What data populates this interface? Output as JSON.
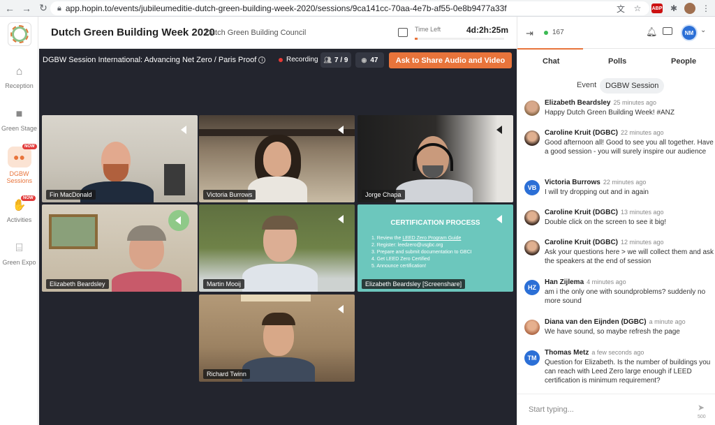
{
  "browser": {
    "url": "app.hopin.to/events/jubileumeditie-dutch-green-building-week-2020/sessions/9ca141cc-70aa-4e7b-af55-0e8b9477a33f",
    "abp_label": "ABP"
  },
  "sidebar": {
    "items": [
      {
        "label": "Reception",
        "icon": "home-icon"
      },
      {
        "label": "Green Stage",
        "icon": "video-icon"
      },
      {
        "label": "DGBW Sessions",
        "icon": "sessions-icon",
        "badge": "NOW"
      },
      {
        "label": "Activities",
        "icon": "activities-icon",
        "badge": "NOW"
      },
      {
        "label": "Green Expo",
        "icon": "expo-icon"
      }
    ]
  },
  "header": {
    "event_title": "Dutch Green Building Week 2020",
    "organizer": "Dutch Green Building Council",
    "time_left_label": "Time Left",
    "time_left_value": "4d:2h:25m",
    "time_progress": 0.03
  },
  "stage": {
    "session_title": "DGBW Session International: Advancing Net Zero / Paris Proof",
    "recording_label": "Recording",
    "speakers_count": "7 / 9",
    "viewers_count": "47",
    "share_button": "Ask to Share Audio and Video",
    "tiles": [
      {
        "name": "Fin MacDonald"
      },
      {
        "name": "Victoria Burrows"
      },
      {
        "name": "Jorge Chapa"
      },
      {
        "name": "Elizabeth Beardsley"
      },
      {
        "name": "Martin Mooij"
      },
      {
        "name": "Elizabeth Beardsley [Screenshare]"
      },
      {
        "name": "Richard Twinn"
      }
    ],
    "screenshare": {
      "title": "CERTIFICATION PROCESS",
      "steps": [
        {
          "n": "1.",
          "pre": "Review the ",
          "link": "LEED Zero Program Guide"
        },
        {
          "n": "2.",
          "pre": "Register: leedzero@usgbc.org",
          "link": ""
        },
        {
          "n": "3.",
          "pre": "Prepare and submit documentation to GBCI",
          "link": ""
        },
        {
          "n": "4.",
          "pre": "Get LEED Zero Certified",
          "link": ""
        },
        {
          "n": "5.",
          "pre": "Announce certification!",
          "link": ""
        }
      ]
    }
  },
  "panel": {
    "online_count": "167",
    "avatar_initials": "NM",
    "tabs": [
      "Chat",
      "Polls",
      "People"
    ],
    "subtabs": [
      "Event",
      "DGBW Session"
    ],
    "messages": [
      {
        "name": "Elizabeth Beardsley",
        "time": "25 minutes ago",
        "text": "Happy Dutch Green Building Week! #ANZ",
        "initials": ""
      },
      {
        "name": "Caroline Kruit (DGBC)",
        "time": "22 minutes ago",
        "text": "Good afternoon all! Good to see you all together. Have a good session - you will surely inspire our audience",
        "initials": ""
      },
      {
        "name": "Victoria Burrows",
        "time": "22 minutes ago",
        "text": "I will try dropping out and in again",
        "initials": "VB"
      },
      {
        "name": "Caroline Kruit (DGBC)",
        "time": "13 minutes ago",
        "text": "Double click on the screen to see it big!",
        "initials": ""
      },
      {
        "name": "Caroline Kruit (DGBC)",
        "time": "12 minutes ago",
        "text": "Ask your questions here > we will collect them and ask the speakers at the end of session",
        "initials": ""
      },
      {
        "name": "Han Zijlema",
        "time": "4 minutes ago",
        "text": "am i the only one with soundproblems? suddenly no more sound",
        "initials": "HZ"
      },
      {
        "name": "Diana van den Eijnden (DGBC)",
        "time": "a minute ago",
        "text": "We have sound, so maybe refresh the page",
        "initials": ""
      },
      {
        "name": "Thomas Metz",
        "time": "a few seconds ago",
        "text": "Question for Elizabeth. Is the number of buildings you can reach with Leed Zero large enough if LEED certification is minimum requirement?",
        "initials": "TM"
      }
    ],
    "input_placeholder": "Start typing...",
    "char_limit": "500"
  }
}
